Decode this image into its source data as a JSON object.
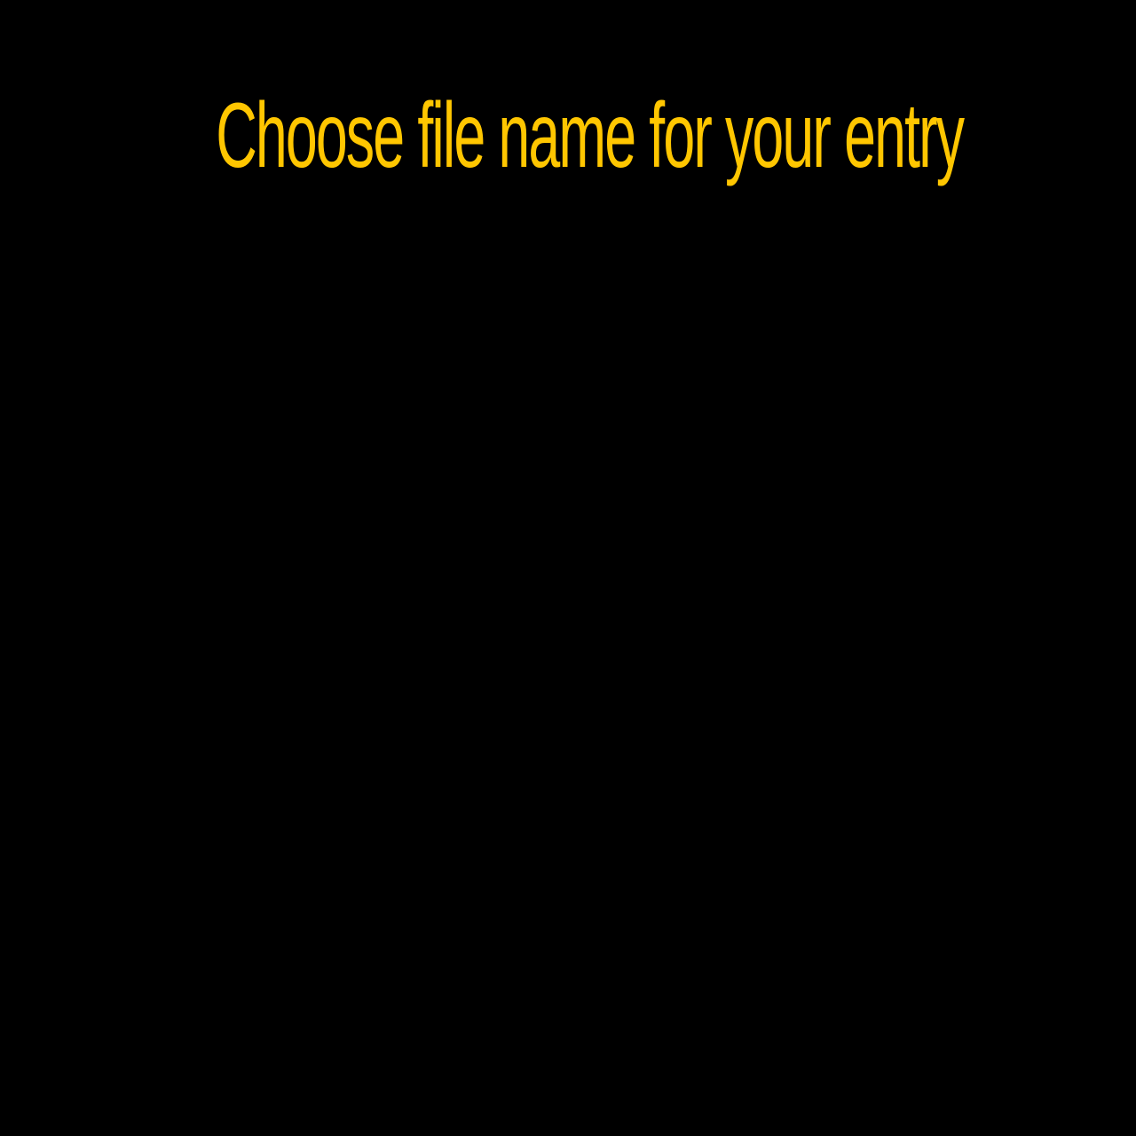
{
  "screen": {
    "title": "Choose file name for your entry",
    "background_color": "#000000",
    "accent_color": "#FFC600"
  }
}
